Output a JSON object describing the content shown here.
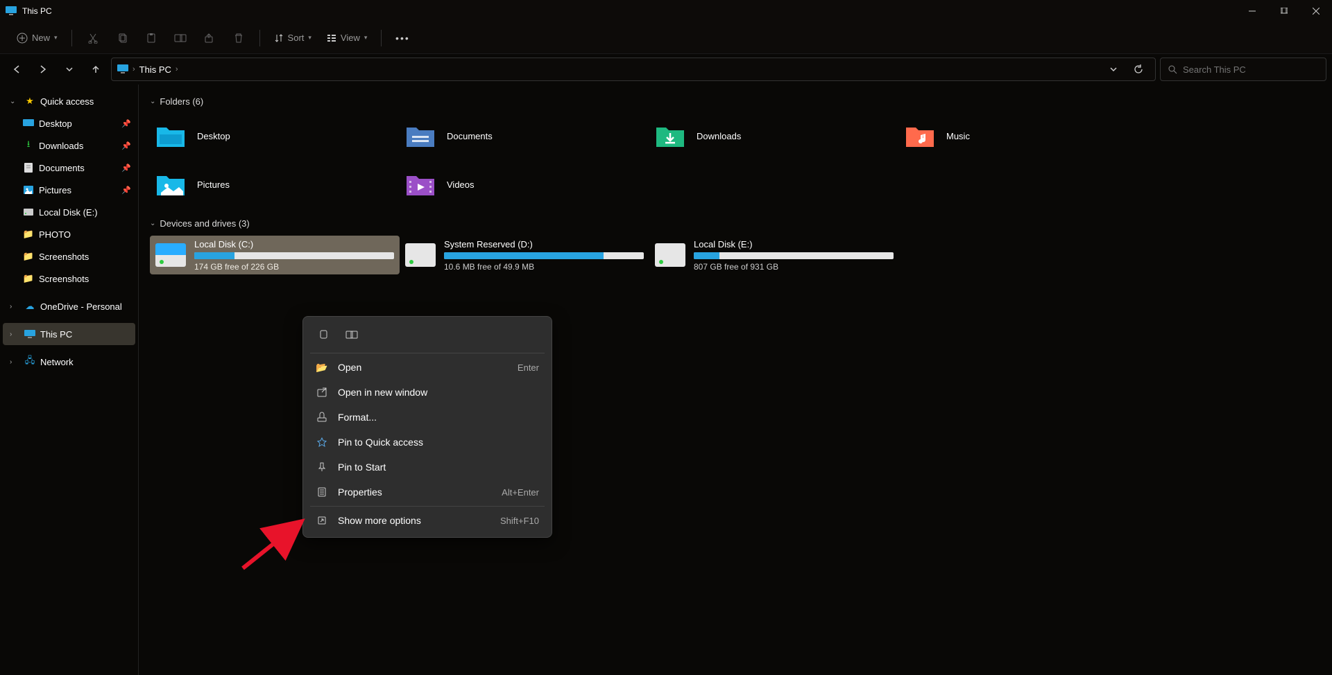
{
  "window": {
    "title": "This PC"
  },
  "toolbar": {
    "new_label": "New",
    "sort_label": "Sort",
    "view_label": "View"
  },
  "breadcrumb": {
    "root": "This PC"
  },
  "search": {
    "placeholder": "Search This PC"
  },
  "sidebar": {
    "quick_access": "Quick access",
    "items": [
      {
        "label": "Desktop",
        "pinned": true
      },
      {
        "label": "Downloads",
        "pinned": true
      },
      {
        "label": "Documents",
        "pinned": true
      },
      {
        "label": "Pictures",
        "pinned": true
      },
      {
        "label": "Local Disk (E:)",
        "pinned": false
      },
      {
        "label": "PHOTO",
        "pinned": false
      },
      {
        "label": "Screenshots",
        "pinned": false
      },
      {
        "label": "Screenshots",
        "pinned": false
      }
    ],
    "onedrive": "OneDrive - Personal",
    "thispc": "This PC",
    "network": "Network"
  },
  "groups": {
    "folders_header": "Folders (6)",
    "drives_header": "Devices and drives (3)"
  },
  "folders": [
    {
      "label": "Desktop"
    },
    {
      "label": "Documents"
    },
    {
      "label": "Downloads"
    },
    {
      "label": "Music"
    },
    {
      "label": "Pictures"
    },
    {
      "label": "Videos"
    }
  ],
  "drives": [
    {
      "name": "Local Disk (C:)",
      "free_text": "174 GB free of 226 GB",
      "used_pct": 20,
      "selected": true
    },
    {
      "name": "System Reserved (D:)",
      "free_text": "10.6 MB free of 49.9 MB",
      "used_pct": 80,
      "selected": false
    },
    {
      "name": "Local Disk (E:)",
      "free_text": "807 GB free of 931 GB",
      "used_pct": 13,
      "selected": false
    }
  ],
  "context_menu": {
    "open": "Open",
    "open_shortcut": "Enter",
    "open_new": "Open in new window",
    "format": "Format...",
    "pin_qa": "Pin to Quick access",
    "pin_start": "Pin to Start",
    "properties": "Properties",
    "properties_shortcut": "Alt+Enter",
    "more": "Show more options",
    "more_shortcut": "Shift+F10"
  }
}
